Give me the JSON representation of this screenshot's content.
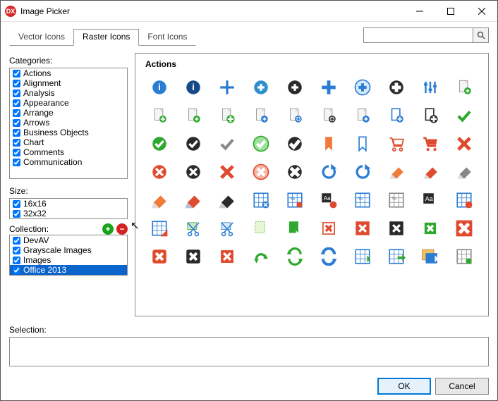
{
  "title": "Image Picker",
  "logo_text": "DX",
  "tabs": [
    {
      "label": "Vector Icons",
      "active": false
    },
    {
      "label": "Raster Icons",
      "active": true
    },
    {
      "label": "Font Icons",
      "active": false
    }
  ],
  "search": {
    "placeholder": ""
  },
  "categories": {
    "label": "Categories:",
    "items": [
      "Actions",
      "Alignment",
      "Analysis",
      "Appearance",
      "Arrange",
      "Arrows",
      "Business Objects",
      "Chart",
      "Comments",
      "Communication"
    ]
  },
  "size": {
    "label": "Size:",
    "items": [
      "16x16",
      "32x32"
    ]
  },
  "collection": {
    "label": "Collection:",
    "items": [
      "DevAV",
      "Grayscale Images",
      "Images",
      "Office 2013"
    ],
    "selected_index": 3
  },
  "icon_group": {
    "title": "Actions"
  },
  "selection": {
    "label": "Selection:"
  },
  "buttons": {
    "ok": "OK",
    "cancel": "Cancel"
  },
  "colors": {
    "blue": "#2b7cd3",
    "darkblue": "#184a8a",
    "black": "#2a2a2a",
    "green": "#2fa82f",
    "red": "#e04a2e",
    "orange": "#f07a3a",
    "cyan": "#2e8fcf",
    "gray": "#888888"
  }
}
